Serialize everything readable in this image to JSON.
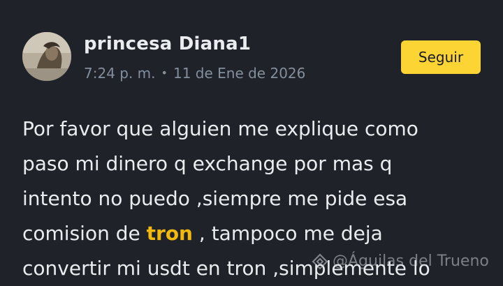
{
  "author": {
    "name": "princesa Diana1",
    "time": "7:24 p. m.",
    "separator": "•",
    "date": "11 de Ene de 2026"
  },
  "follow_button": {
    "label": "Seguir"
  },
  "post": {
    "lines": [
      "Por favor que alguien me explique como",
      "paso mi dinero q exchange por mas q",
      "intento no puedo ,siempre me pide esa"
    ],
    "line4_before": "comision de ",
    "mention": "tron",
    "line4_after": " , tampoco me deja",
    "line5": "convertir mi usdt en tron ,simplemente lo"
  },
  "watermark": {
    "text": "@Águilas del Trueno",
    "icon": "binance-diamond-icon"
  },
  "colors": {
    "background": "#1f2329",
    "accent": "#fcd535",
    "mention": "#f0b90b",
    "muted_text": "#848e9c"
  }
}
